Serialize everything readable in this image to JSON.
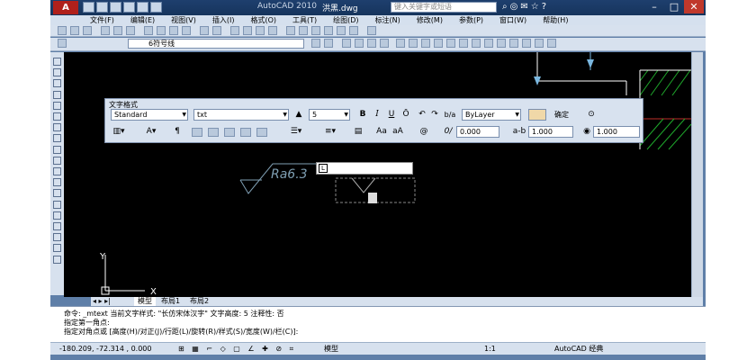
{
  "titlebar": {
    "logo_text": "A",
    "app_title": "AutoCAD 2010",
    "file_name": "洪黑.dwg",
    "search_placeholder": "键入关键字或短语"
  },
  "menu": [
    "文件(F)",
    "编辑(E)",
    "视图(V)",
    "插入(I)",
    "格式(O)",
    "工具(T)",
    "绘图(D)",
    "标注(N)",
    "修改(M)",
    "参数(P)",
    "窗口(W)",
    "帮助(H)"
  ],
  "layer_toolbar": {
    "layer_value": "6符号线"
  },
  "text_format": {
    "title": "文字格式",
    "style": "Standard",
    "font": "txt",
    "height": "5",
    "bold": "B",
    "italic": "I",
    "overline": "Ō",
    "color": "ByLayer",
    "ok_label": "确定",
    "oblique": "0.000",
    "tracking": "1.000",
    "width_factor": "1.000",
    "case_upper": "Aa",
    "case_lower": "aA",
    "symbol": "@"
  },
  "drawing": {
    "roughness_label": "Ra6.3",
    "axis_x": "X",
    "axis_y": "Y"
  },
  "tabs": {
    "model": "模型",
    "layout1": "布局1",
    "layout2": "布局2"
  },
  "command": {
    "line1": "命令:  _mtext 当前文字样式:  \"长仿宋体汉字\"  文字高度:  5  注释性:  否",
    "line2": "指定第一角点:",
    "line3": "指定对角点或 [高度(H)/对正(J)/行距(L)/旋转(R)/样式(S)/宽度(W)/栏(C)]:"
  },
  "status": {
    "coords": "-180.209, -72.314 , 0.000",
    "model_label": "模型",
    "scale": "1:1",
    "workspace": "AutoCAD 经典"
  }
}
